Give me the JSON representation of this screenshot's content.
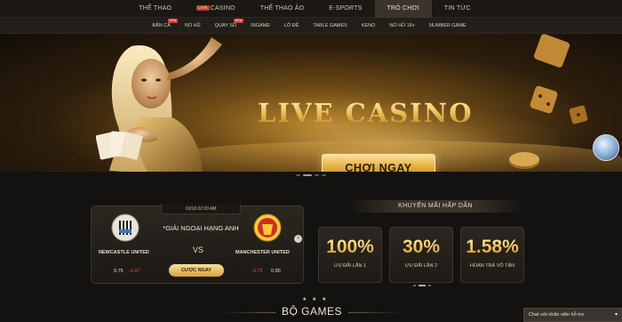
{
  "topnav": {
    "tabs": [
      {
        "label": "THỂ THAO"
      },
      {
        "badge": "LIVE",
        "label": "CASINO"
      },
      {
        "label": "THỂ THAO ẢO"
      },
      {
        "label": "E-SPORTS"
      },
      {
        "label": "TRÒ CHƠI",
        "active": true
      },
      {
        "label": "TIN TỨC"
      }
    ]
  },
  "subnav": {
    "items": [
      {
        "label": "BẮN CÁ",
        "hot": "NEW"
      },
      {
        "label": "NỔ HŨ"
      },
      {
        "label": "QUAY SỐ",
        "hot": "NEW"
      },
      {
        "label": "INGAME"
      },
      {
        "label": "LÔ ĐỀ"
      },
      {
        "label": "TABLE GAMES"
      },
      {
        "label": "KENO"
      },
      {
        "label": "NỔ HŨ 18+"
      },
      {
        "label": "NUMBER GAME"
      }
    ]
  },
  "banner": {
    "title": "LIVE CASINO",
    "cta": "CHƠI NGAY"
  },
  "match": {
    "time": "10/18 02:00 AM",
    "league": "*GIẢI NGOẠI HẠNG ANH",
    "vs": "VS",
    "home": {
      "name": "NEWCASTLE UNITED",
      "odd1": "0.75",
      "odd2": "-0.97"
    },
    "away": {
      "name": "MANCHESTER UNITED",
      "odd1": "-0.75",
      "odd2": "0.90"
    },
    "bet_label": "CƯỢC NGAY",
    "prev": "‹",
    "next": "›"
  },
  "promos": {
    "title": "KHUYẾN MÃI HẤP DẪN",
    "cards": [
      {
        "value": "100%",
        "label": "ƯU ĐÃI LẦN 1"
      },
      {
        "value": "30%",
        "label": "ƯU ĐÃI LẦN 2"
      },
      {
        "value": "1.58%",
        "label": "HOÀN TRẢ VÔ TẬN"
      }
    ]
  },
  "games": {
    "stars": "★ ★ ★",
    "title": "BỘ GAMES"
  },
  "chat": {
    "label": "Chat với nhân viên hỗ trợ",
    "caret": "▾"
  },
  "colors": {
    "gold": "#f0c65c",
    "accent_red": "#e14a3a",
    "bg": "#141210"
  }
}
